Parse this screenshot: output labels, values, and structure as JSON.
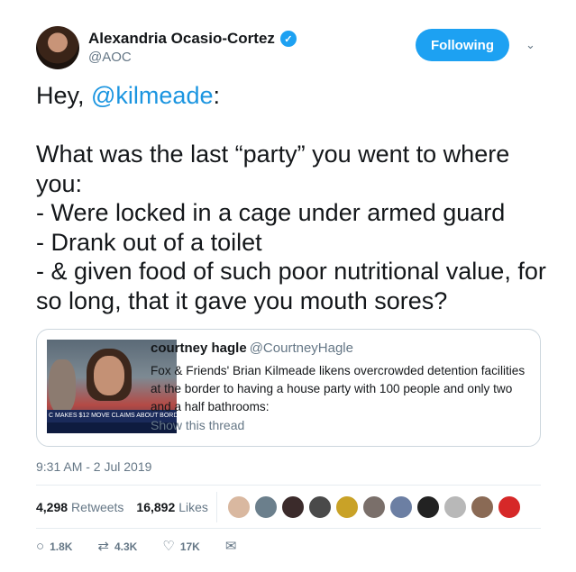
{
  "author": {
    "name": "Alexandria Ocasio-Cortez",
    "handle": "@AOC",
    "verified_icon": "✓"
  },
  "follow_button": {
    "label": "Following",
    "color": "#1da1f2"
  },
  "caret_icon": "⌄",
  "tweet": {
    "greeting_prefix": "Hey, ",
    "mention": "@kilmeade",
    "greeting_suffix": ":",
    "body": "What was the last “party” you went to where you:\n-  Were locked in a cage under armed guard\n- Drank out of a toilet\n- & given food of such poor nutritional value, for so long, that it gave you mouth sores?"
  },
  "quote": {
    "name": "courtney hagle",
    "handle": "@CourtneyHagle",
    "text": "Fox & Friends' Brian Kilmeade likens overcrowded detention facilities at the border to having a house party with 100 people and only two and a half bathrooms:",
    "show_thread": "Show this thread",
    "image_chyron": "C MAKES $12 MOVE CLAIMS ABOUT BORD"
  },
  "timestamp": "9:31 AM - 2 Jul 2019",
  "stats": {
    "retweets_count": "4,298",
    "retweets_label": "Retweets",
    "likes_count": "16,892",
    "likes_label": "Likes"
  },
  "likers_colors": [
    "#d9b8a0",
    "#6b7f8c",
    "#3b2b2b",
    "#4a4a4a",
    "#c9a227",
    "#7a6f6a",
    "#6c7fa3",
    "#222222",
    "#b8b8b8",
    "#8a6a55",
    "#d62828"
  ],
  "actions": {
    "reply_icon": "○",
    "reply_count": "1.8K",
    "retweet_icon": "⇄",
    "retweet_count": "4.3K",
    "like_icon": "♡",
    "like_count": "17K",
    "dm_icon": "✉"
  }
}
